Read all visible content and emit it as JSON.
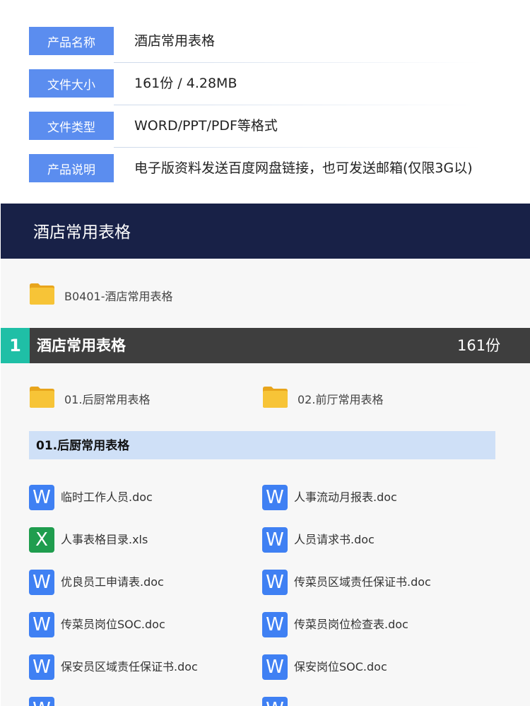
{
  "info": {
    "rows": [
      {
        "label": "产品名称",
        "value": "酒店常用表格"
      },
      {
        "label": "文件大小",
        "value": "161份 / 4.28MB"
      },
      {
        "label": "文件类型",
        "value": "WORD/PPT/PDF等格式"
      },
      {
        "label": "产品说明",
        "value": "电子版资料发送百度网盘链接，也可发送邮箱(仅限3G以)"
      }
    ]
  },
  "header": {
    "title": "酒店常用表格"
  },
  "root_folder": {
    "name": "B0401-酒店常用表格",
    "icon": "folder-icon"
  },
  "section": {
    "number": "1",
    "name": "酒店常用表格",
    "count": "161份"
  },
  "subfolders": [
    {
      "name": "01.后厨常用表格",
      "icon": "folder-icon"
    },
    {
      "name": "02.前厅常用表格",
      "icon": "folder-icon"
    }
  ],
  "subsection": {
    "title": "01.后厨常用表格"
  },
  "files": [
    {
      "type": "word",
      "icon_letter": "W",
      "name": "临时工作人员.doc"
    },
    {
      "type": "word",
      "icon_letter": "W",
      "name": "人事流动月报表.doc"
    },
    {
      "type": "excel",
      "icon_letter": "X",
      "name": "人事表格目录.xls"
    },
    {
      "type": "word",
      "icon_letter": "W",
      "name": "人员请求书.doc"
    },
    {
      "type": "word",
      "icon_letter": "W",
      "name": "优良员工申请表.doc"
    },
    {
      "type": "word",
      "icon_letter": "W",
      "name": "传菜员区域责任保证书.doc"
    },
    {
      "type": "word",
      "icon_letter": "W",
      "name": "传菜员岗位SOC.doc"
    },
    {
      "type": "word",
      "icon_letter": "W",
      "name": "传菜员岗位检查表.doc"
    },
    {
      "type": "word",
      "icon_letter": "W",
      "name": "保安员区域责任保证书.doc"
    },
    {
      "type": "word",
      "icon_letter": "W",
      "name": "保安岗位SOC.doc"
    },
    {
      "type": "word",
      "icon_letter": "W",
      "name": ""
    },
    {
      "type": "word",
      "icon_letter": "W",
      "name": ""
    }
  ],
  "colors": {
    "tag_blue": "#5b8def",
    "header_navy": "#182147",
    "section_dark": "#3e3e3e",
    "section_teal": "#1fbfa6",
    "subsection_light_blue": "#cfe0f7",
    "word_blue": "#3f80f3",
    "excel_green": "#1f9d4e",
    "folder_yellow": "#f7c437"
  }
}
